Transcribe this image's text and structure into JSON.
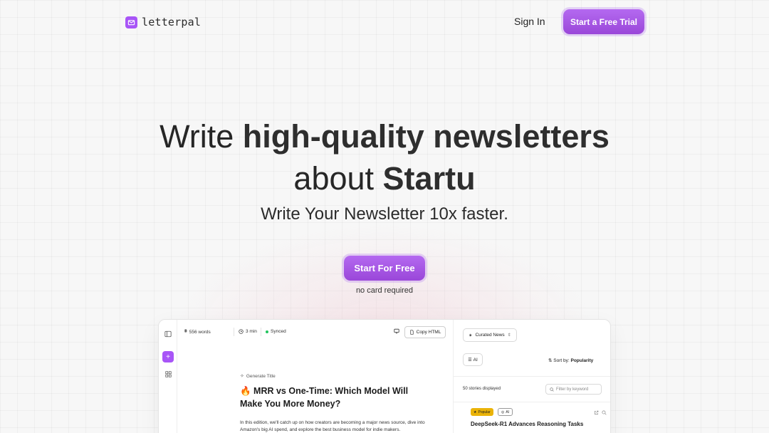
{
  "header": {
    "logo_text": "letterpal",
    "sign_in": "Sign In",
    "trial_button": "Start a Free Trial"
  },
  "hero": {
    "title_part1": "Write ",
    "title_bold1": "high-quality newsletters",
    "title_part2": "about ",
    "title_bold2": "Startu",
    "subtitle": "Write Your Newsletter 10x faster.",
    "cta_button": "Start For Free",
    "cta_note": "no card required"
  },
  "app_preview": {
    "toolbar": {
      "words": "556 words",
      "read_time": "3 min",
      "sync_status": "Synced",
      "copy_button": "Copy HTML"
    },
    "editor": {
      "generate_title": "Generate Title",
      "doc_title": "🔥 MRR vs One-Time: Which Model Will Make You More Money?",
      "doc_body": "In this edition, we'll catch up on how creators are becoming a major news source, dive into Amazon's big AI spend, and explore the best business model for indie makers."
    },
    "news_panel": {
      "source_select": "Curated News",
      "topic_chip": "AI",
      "sort_label": "Sort by: ",
      "sort_value": "Popularity",
      "count": "50 stories displayed",
      "filter_placeholder": "Filter by keyword",
      "story": {
        "badge_popular": "Popular",
        "badge_ai": "AI",
        "title": "DeepSeek-R1 Advances Reasoning Tasks"
      }
    }
  },
  "colors": {
    "accent": "#a855f7",
    "badge_popular": "#eab308",
    "synced": "#22c55e"
  }
}
